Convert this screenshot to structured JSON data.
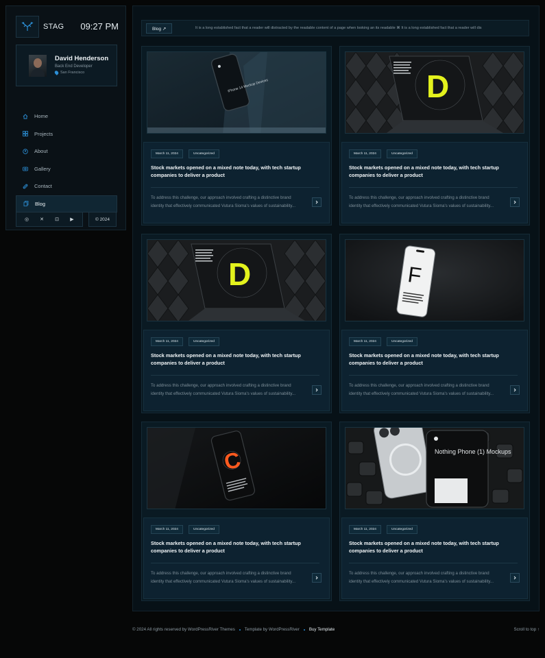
{
  "brand": {
    "name": "STAG",
    "logo_icon": "antler-logo-icon",
    "accent": "#2c8fd6"
  },
  "clock": "09:27 PM",
  "profile": {
    "name": "David Henderson",
    "role": "Back End Developer",
    "location": "San Francisco"
  },
  "nav": [
    {
      "label": "Home",
      "icon": "home-icon"
    },
    {
      "label": "Projects",
      "icon": "grid-icon"
    },
    {
      "label": "About",
      "icon": "user-icon"
    },
    {
      "label": "Gallery",
      "icon": "camera-icon"
    },
    {
      "label": "Contact",
      "icon": "send-icon"
    },
    {
      "label": "Blog",
      "icon": "document-icon",
      "active": true
    }
  ],
  "social": [
    "dribbble-icon",
    "x-icon",
    "instagram-icon",
    "youtube-icon"
  ],
  "year": "© 2024",
  "ticker": {
    "tag": "Blog ↗",
    "text": "It is a long established fact that a reader will distracted by the readable content of a page when looking an its readable ⌘ It is a long established fact that a reader will dis"
  },
  "posts": [
    {
      "date": "March 11, 2024",
      "category": "Uncategorized",
      "title": "Stock markets opened on a mixed note today, with tech startup companies to deliver a product",
      "excerpt": "To address this challenge, our approach involved crafting a distinctive brand identity that effectively communicated Vutura Sioma's values of sustainability..."
    },
    {
      "date": "March 11, 2024",
      "category": "Uncategorized",
      "title": "Stock markets opened on a mixed note today, with tech startup companies to deliver a product",
      "excerpt": "To address this challenge, our approach involved crafting a distinctive brand identity that effectively communicated Vutura Sioma's values of sustainability..."
    },
    {
      "date": "March 11, 2024",
      "category": "Uncategorized",
      "title": "Stock markets opened on a mixed note today, with tech startup companies to deliver a product",
      "excerpt": "To address this challenge, our approach involved crafting a distinctive brand identity that effectively communicated Vutura Sioma's values of sustainability..."
    },
    {
      "date": "March 11, 2024",
      "category": "Uncategorized",
      "title": "Stock markets opened on a mixed note today, with tech startup companies to deliver a product",
      "excerpt": "To address this challenge, our approach involved crafting a distinctive brand identity that effectively communicated Vutura Sioma's values of sustainability..."
    },
    {
      "date": "March 11, 2024",
      "category": "Uncategorized",
      "title": "Stock markets opened on a mixed note today, with tech startup companies to deliver a product",
      "excerpt": "To address this challenge, our approach involved crafting a distinctive brand identity that effectively communicated Vutura Sioma's values of sustainability..."
    },
    {
      "date": "March 11, 2024",
      "category": "Uncategorized",
      "title": "Stock markets opened on a mixed note today, with tech startup companies to deliver a product",
      "excerpt": "To address this challenge, our approach involved crafting a distinctive brand identity that effectively communicated Vutura Sioma's values of sustainability..."
    }
  ],
  "images": [
    {
      "caption": "iPhone 14 Mockup Devices"
    },
    {
      "letter": "D"
    },
    {
      "letter": "D"
    },
    {
      "letter": "F"
    },
    {
      "letter": "C"
    },
    {
      "caption": "Nothing Phone (1) Mockups"
    }
  ],
  "footer": {
    "copyright": "© 2024 All rights reserved by WordPressRiver Themes",
    "template_by": "Template by WordPressRiver",
    "buy": "Buy Template",
    "scroll": "Scroll to top ↑"
  }
}
